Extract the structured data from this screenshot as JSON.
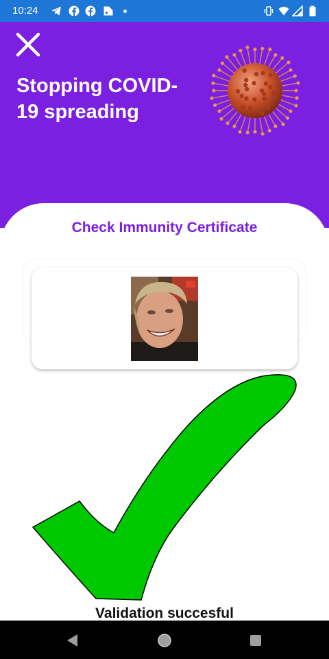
{
  "status_bar": {
    "time": "10:24",
    "left_icons": [
      "telegram-icon",
      "facebook-icon",
      "facebook-icon",
      "app-icon",
      "dot-icon"
    ],
    "right_icons": [
      "vibrate-icon",
      "wifi-icon",
      "signal-icon",
      "battery-icon"
    ],
    "color": "#1e76d6"
  },
  "header": {
    "title": "Stopping COVID-19 spreading",
    "background": "#7b1fe0",
    "close_icon": "close-icon",
    "image": "virus-illustration"
  },
  "main": {
    "section_title": "Check Immunity Certificate",
    "photo": "holder-photo",
    "result_icon": "checkmark-icon",
    "result_color": "#00c800",
    "result_text": "Validation succesful"
  },
  "nav_bar": {
    "buttons": [
      "back-icon",
      "home-icon",
      "recents-icon"
    ]
  }
}
